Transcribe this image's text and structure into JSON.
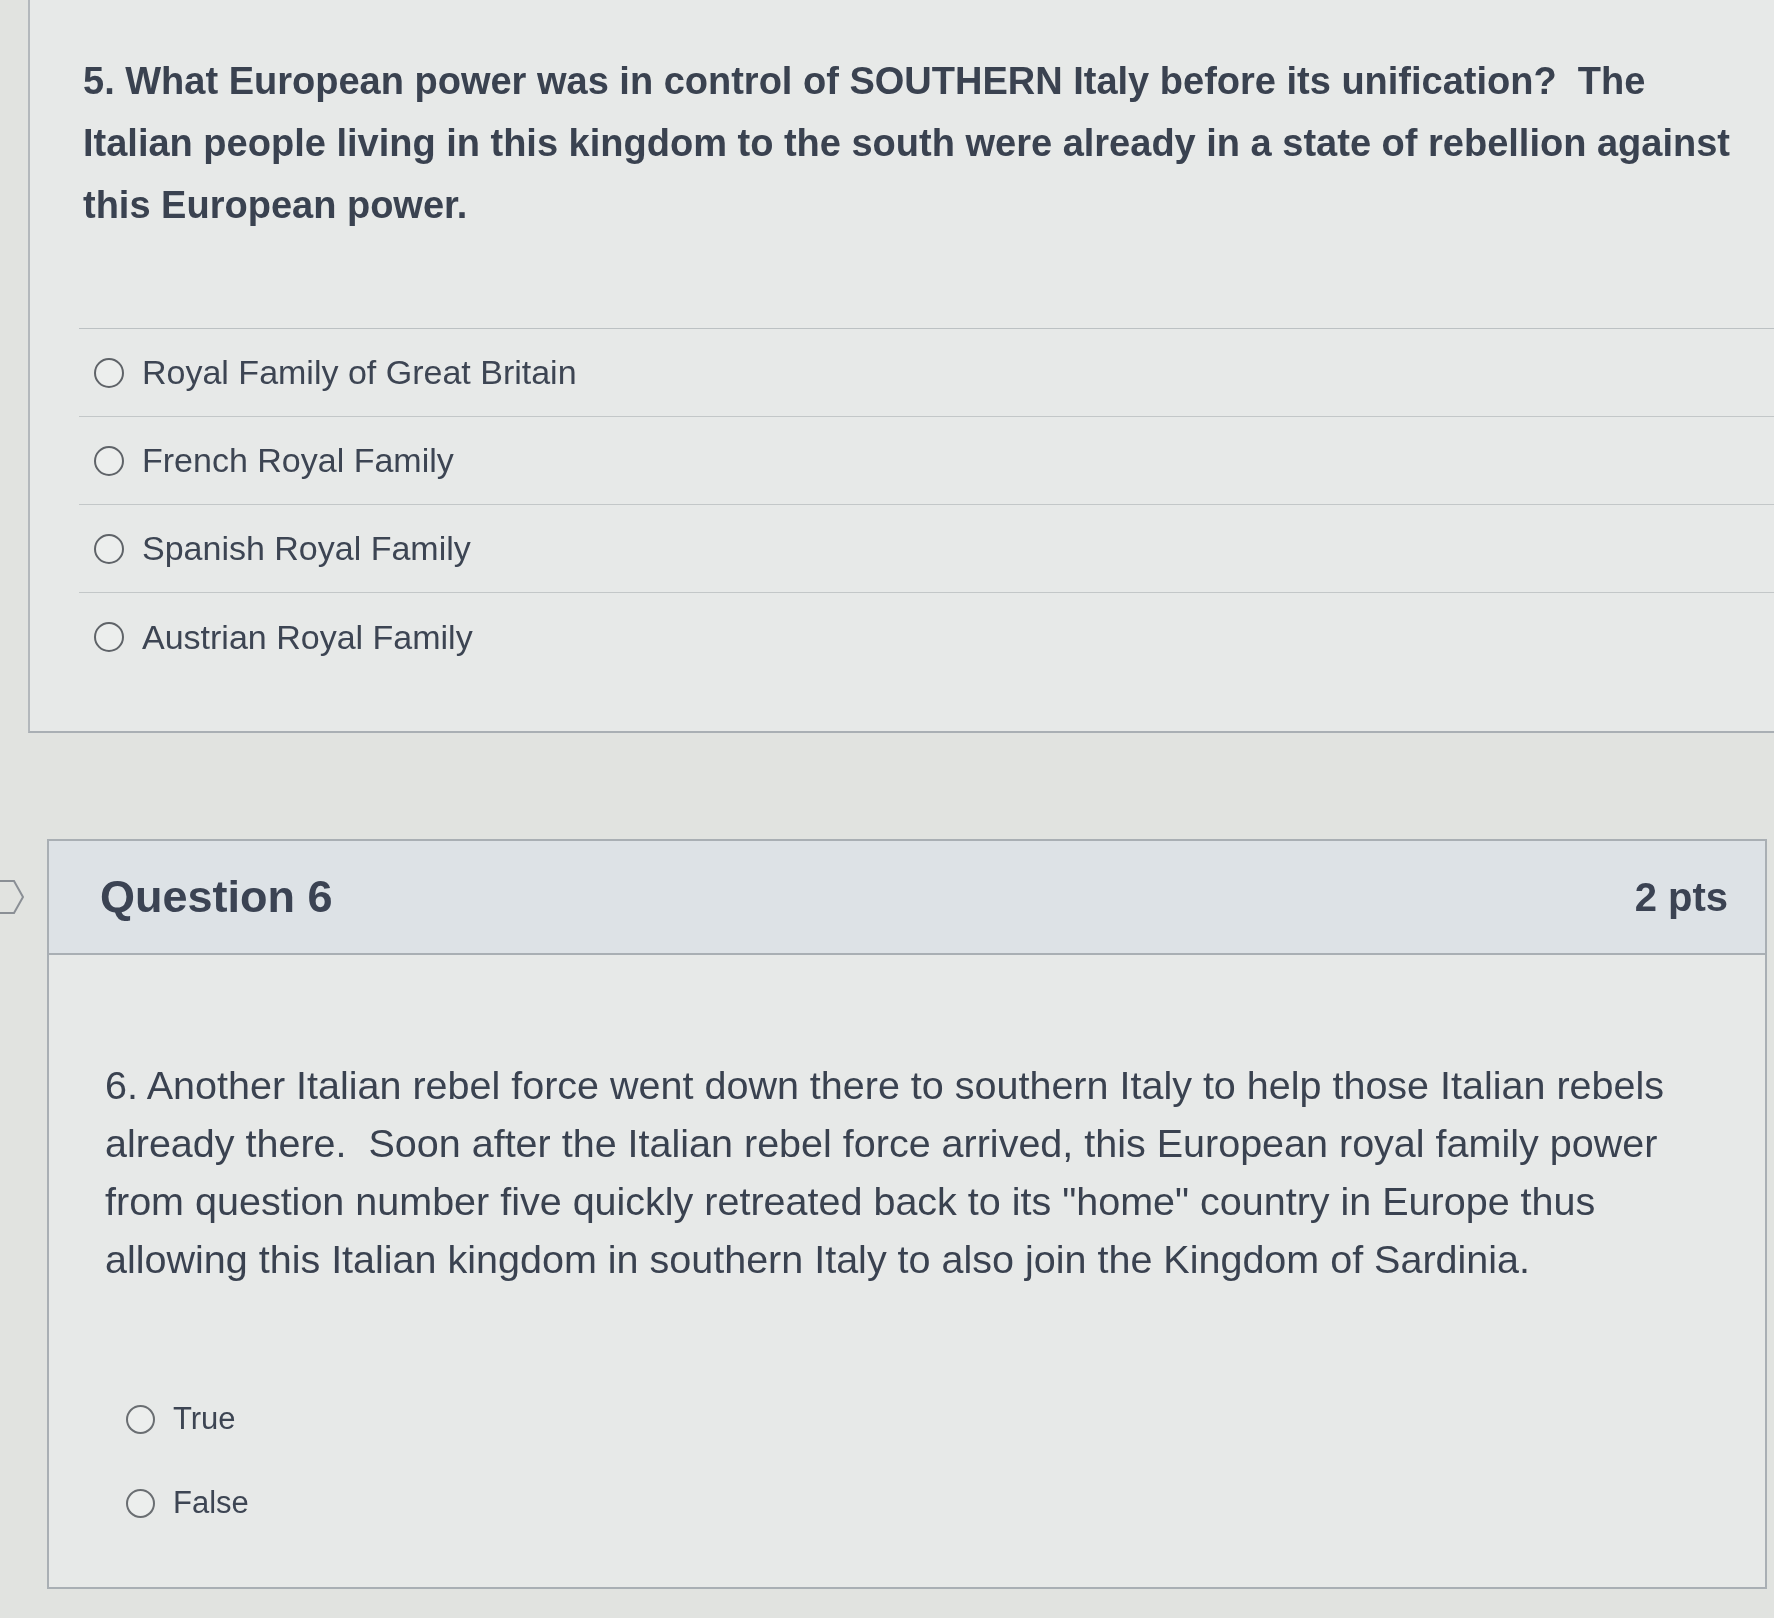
{
  "questions": [
    {
      "text": "5. What European power was in control of SOUTHERN Italy before its unification?  The Italian people living in this kingdom to the south were already in a state of rebellion against this European power.",
      "answers": [
        {
          "label": "Royal Family of Great Britain",
          "selected": false
        },
        {
          "label": "French Royal Family",
          "selected": false
        },
        {
          "label": "Spanish Royal Family",
          "selected": false
        },
        {
          "label": "Austrian Royal Family",
          "selected": false
        }
      ]
    },
    {
      "header": {
        "title": "Question 6",
        "points": "2 pts"
      },
      "text": "6. Another Italian rebel force went down there to southern Italy to help those Italian rebels already there.  Soon after the Italian rebel force arrived, this European royal family power from question number five quickly retreated back to its \"home\" country in Europe thus allowing this Italian kingdom in southern Italy to also join the Kingdom of Sardinia.",
      "answers": [
        {
          "label": "True",
          "selected": false
        },
        {
          "label": "False",
          "selected": false
        }
      ]
    }
  ]
}
